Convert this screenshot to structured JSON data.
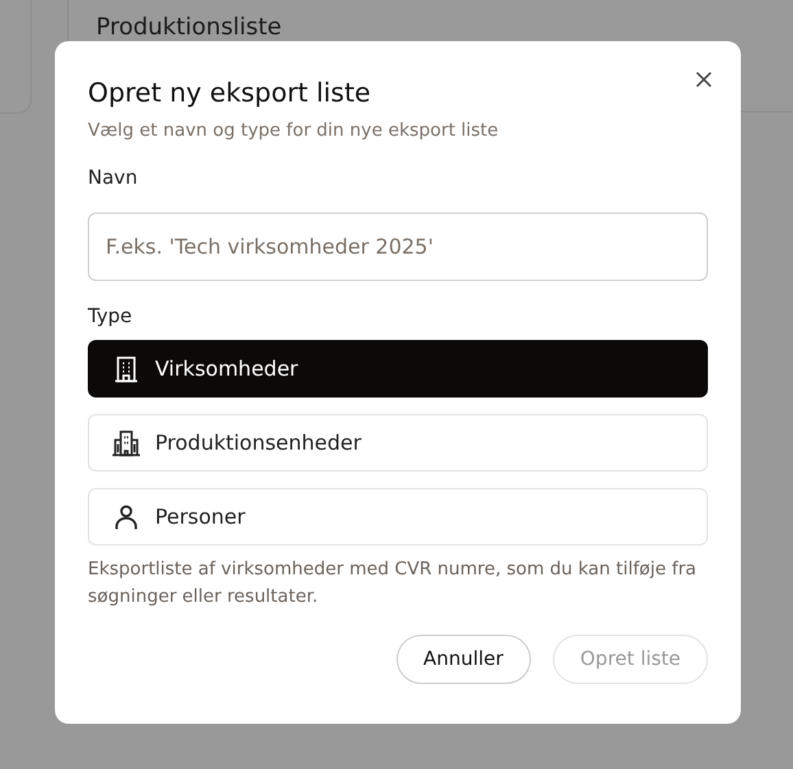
{
  "background": {
    "card_title": "Produktionsliste"
  },
  "dialog": {
    "title": "Opret ny eksport liste",
    "subtitle": "Vælg et navn og type for din nye eksport liste",
    "name_label": "Navn",
    "name_field": {
      "placeholder": "F.eks. 'Tech virksomheder 2025'"
    },
    "type_label": "Type",
    "types": [
      {
        "kind": "building",
        "label": "Virksomheder",
        "selected": true
      },
      {
        "kind": "buildings",
        "label": "Produktionsenheder",
        "selected": false
      },
      {
        "kind": "person",
        "label": "Personer",
        "selected": false
      }
    ],
    "description": "Eksportliste af virksomheder med CVR numre, som du kan tilføje fra søgninger eller resultater.",
    "buttons": [
      {
        "label": "Annuller",
        "disabled": false
      },
      {
        "label": "Opret liste",
        "disabled": true
      }
    ]
  }
}
